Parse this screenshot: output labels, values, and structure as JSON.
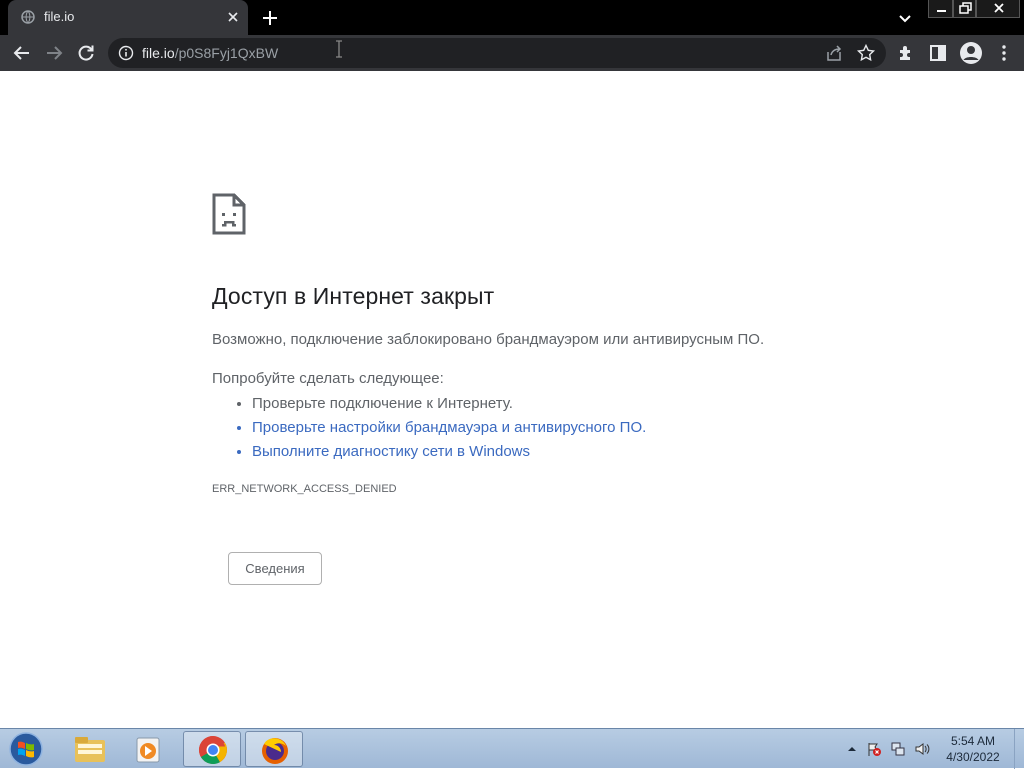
{
  "browser": {
    "tab": {
      "title": "file.io"
    },
    "address": {
      "host": "file.io",
      "path": "/p0S8Fyj1QxBW"
    }
  },
  "page": {
    "heading": "Доступ в Интернет закрыт",
    "summary": "Возможно, подключение заблокировано брандмауэром или антивирусным ПО.",
    "suggestions_heading": "Попробуйте сделать следующее:",
    "suggestions": [
      "Проверьте подключение к Интернету.",
      "Проверьте настройки брандмауэра и антивирусного ПО.",
      "Выполните диагностику сети в Windows"
    ],
    "error_code": "ERR_NETWORK_ACCESS_DENIED",
    "details_button": "Сведения"
  },
  "taskbar": {
    "time": "5:54 AM",
    "date": "4/30/2022",
    "apps": [
      "windows-explorer-icon",
      "media-player-icon",
      "chrome-icon",
      "firefox-icon"
    ]
  },
  "colors": {
    "link": "#3b6ac0",
    "text": "#5f6368",
    "heading": "#202124",
    "chrome_dark": "#35363a"
  }
}
